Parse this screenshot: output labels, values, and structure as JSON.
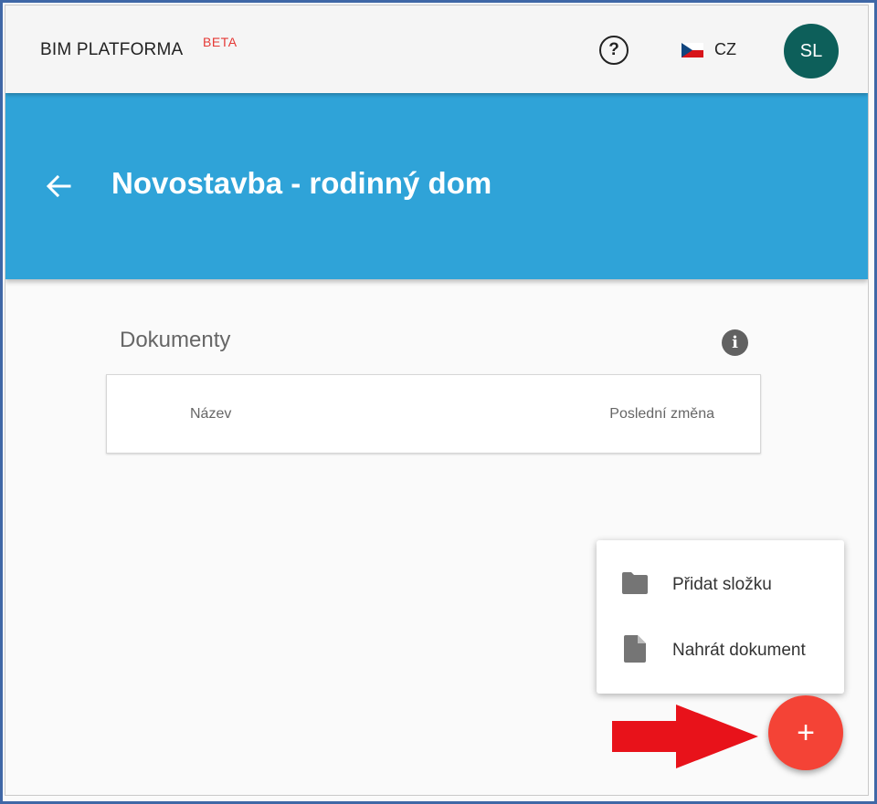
{
  "topbar": {
    "brand": "BIM PLATFORMA",
    "badge": "BETA",
    "help_glyph": "?",
    "language": "CZ",
    "avatar_initials": "SL"
  },
  "header": {
    "title": "Novostavba - rodinný dom"
  },
  "documents": {
    "title": "Dokumenty",
    "info_glyph": "i",
    "columns": {
      "name": "Název",
      "last_changed": "Poslední změna"
    }
  },
  "speed_dial": {
    "items": [
      {
        "label": "Přidat složku",
        "icon": "folder-icon"
      },
      {
        "label": "Nahrát dokument",
        "icon": "file-icon"
      }
    ],
    "fab_glyph": "+"
  },
  "colors": {
    "header_blue": "#2fa3d8",
    "fab_red": "#f44336",
    "avatar_teal": "#0d5f5a",
    "annotation_arrow": "#e8121a",
    "beta_red": "#e53935"
  }
}
